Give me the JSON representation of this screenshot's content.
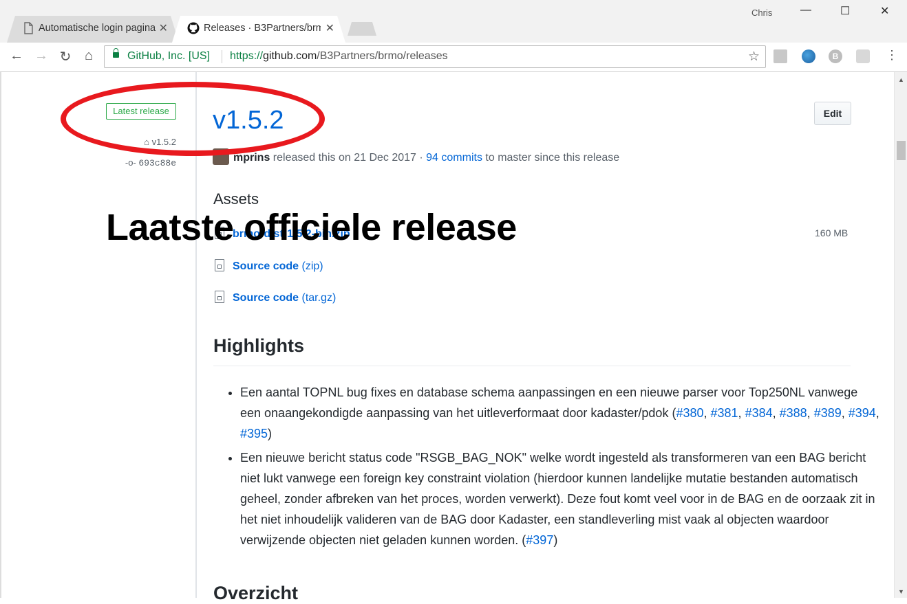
{
  "browser": {
    "tabs": [
      {
        "label": "Automatische login pagina",
        "active": false
      },
      {
        "label": "Releases · B3Partners/brmo",
        "active": true
      }
    ],
    "user": "Chris",
    "site_identity": "GitHub, Inc. [US]",
    "url_scheme": "https://",
    "url_host": "github.com",
    "url_path": "/B3Partners/brmo/releases"
  },
  "sidebar": {
    "latest_badge": "Latest release",
    "tag": "v1.5.2",
    "commit": "693c88e"
  },
  "release": {
    "title": "v1.5.2",
    "edit_label": "Edit",
    "author": "mprins",
    "released_text": " released this on 21 Dec 2017 · ",
    "commits_link": "94 commits",
    "commits_suffix": " to master since this release"
  },
  "assets": {
    "heading": "Assets",
    "items": [
      {
        "name": "brmo-dist-1.5.2-bin.zip",
        "size": "160 MB"
      },
      {
        "name": "Source code",
        "format": "(zip)"
      },
      {
        "name": "Source code",
        "format": "(tar.gz)"
      }
    ]
  },
  "highlights": {
    "heading": "Highlights",
    "bullet1": {
      "text": "Een aantal TOPNL bug fixes en database schema aanpassingen en een nieuwe parser voor Top250NL vanwege een onaangekondigde aanpassing van het uitleverformaat door kadaster/pdok (",
      "links": [
        "#380",
        "#381",
        "#384",
        "#388",
        "#389",
        "#394",
        "#395"
      ],
      "end": ")"
    },
    "bullet2": {
      "text": "Een nieuwe bericht status code \"RSGB_BAG_NOK\" welke wordt ingesteld als transformeren van een BAG bericht niet lukt vanwege een foreign key constraint violation (hierdoor kunnen landelijke mutatie bestanden automatisch geheel, zonder afbreken van het proces, worden verwerkt). Deze fout komt veel voor in de BAG en de oorzaak zit in het niet inhoudelijk valideren van de BAG door Kadaster, een standleverling mist vaak al objecten waardoor verwijzende objecten niet geladen kunnen worden. (",
      "link": "#397",
      "end": ")"
    },
    "next_heading": "Overzicht"
  },
  "annotation": {
    "text": "Laatste officiele release",
    "color": "#e8191e"
  }
}
